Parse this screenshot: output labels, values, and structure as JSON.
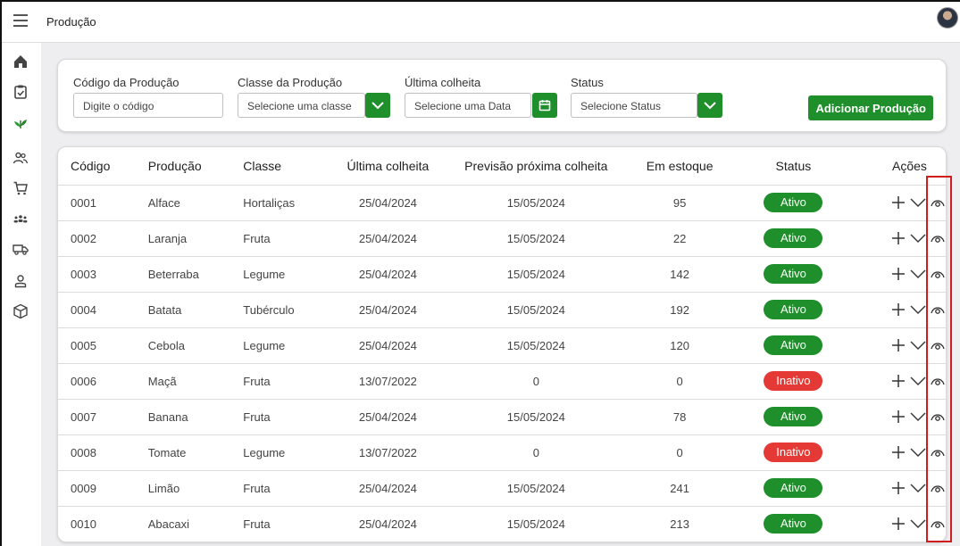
{
  "app": {
    "title": "Produção"
  },
  "colors": {
    "accent": "#1e8f2a",
    "active": "#1e8f2a",
    "inactive": "#e53935",
    "highlight": "#d01c1c"
  },
  "sidebar": {
    "items": [
      {
        "icon": "home-icon"
      },
      {
        "icon": "clipboard-icon"
      },
      {
        "icon": "plant-icon",
        "active": true
      },
      {
        "icon": "users-icon"
      },
      {
        "icon": "cart-icon"
      },
      {
        "icon": "group-icon"
      },
      {
        "icon": "truck-icon"
      },
      {
        "icon": "user-icon"
      },
      {
        "icon": "box-icon"
      }
    ]
  },
  "filters": {
    "codigo": {
      "label": "Código da Produção",
      "placeholder": "Digite o código"
    },
    "classe": {
      "label": "Classe da Produção",
      "placeholder": "Selecione uma classe"
    },
    "ultima": {
      "label": "Última colheita",
      "placeholder": "Selecione uma Data"
    },
    "status": {
      "label": "Status",
      "placeholder": "Selecione Status"
    },
    "add_label": "Adicionar Produção"
  },
  "table": {
    "headers": [
      "Código",
      "Produção",
      "Classe",
      "Última colheita",
      "Previsão próxima colheita",
      "Em estoque",
      "Status",
      "Ações"
    ],
    "rows": [
      {
        "codigo": "0001",
        "producao": "Alface",
        "classe": "Hortaliças",
        "ultima": "25/04/2024",
        "previsao": "15/05/2024",
        "estoque": "95",
        "status": "Ativo"
      },
      {
        "codigo": "0002",
        "producao": "Laranja",
        "classe": "Fruta",
        "ultima": "25/04/2024",
        "previsao": "15/05/2024",
        "estoque": "22",
        "status": "Ativo"
      },
      {
        "codigo": "0003",
        "producao": "Beterraba",
        "classe": "Legume",
        "ultima": "25/04/2024",
        "previsao": "15/05/2024",
        "estoque": "142",
        "status": "Ativo"
      },
      {
        "codigo": "0004",
        "producao": "Batata",
        "classe": "Tubérculo",
        "ultima": "25/04/2024",
        "previsao": "15/05/2024",
        "estoque": "192",
        "status": "Ativo"
      },
      {
        "codigo": "0005",
        "producao": "Cebola",
        "classe": "Legume",
        "ultima": "25/04/2024",
        "previsao": "15/05/2024",
        "estoque": "120",
        "status": "Ativo"
      },
      {
        "codigo": "0006",
        "producao": "Maçã",
        "classe": "Fruta",
        "ultima": "13/07/2022",
        "previsao": "0",
        "estoque": "0",
        "status": "Inativo"
      },
      {
        "codigo": "0007",
        "producao": "Banana",
        "classe": "Fruta",
        "ultima": "25/04/2024",
        "previsao": "15/05/2024",
        "estoque": "78",
        "status": "Ativo"
      },
      {
        "codigo": "0008",
        "producao": "Tomate",
        "classe": "Legume",
        "ultima": "13/07/2022",
        "previsao": "0",
        "estoque": "0",
        "status": "Inativo"
      },
      {
        "codigo": "0009",
        "producao": "Limão",
        "classe": "Fruta",
        "ultima": "25/04/2024",
        "previsao": "15/05/2024",
        "estoque": "241",
        "status": "Ativo"
      },
      {
        "codigo": "0010",
        "producao": "Abacaxi",
        "classe": "Fruta",
        "ultima": "25/04/2024",
        "previsao": "15/05/2024",
        "estoque": "213",
        "status": "Ativo"
      }
    ]
  }
}
